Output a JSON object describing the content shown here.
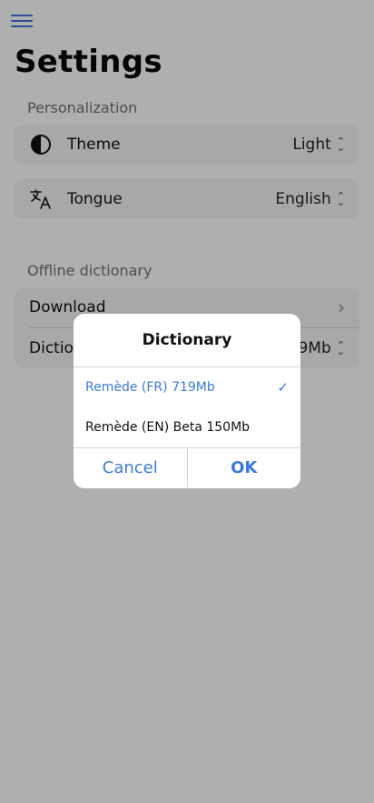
{
  "header": {
    "menu_icon": "hamburger-menu-icon",
    "title": "Settings"
  },
  "sections": {
    "personalization": {
      "label": "Personalization",
      "theme": {
        "icon": "half-circle-contrast-icon",
        "label": "Theme",
        "value": "Light"
      },
      "tongue": {
        "icon": "translate-icon",
        "label": "Tongue",
        "value": "English"
      }
    },
    "offline": {
      "label": "Offline dictionary",
      "download": {
        "label": "Download"
      },
      "dictionary": {
        "label": "Dictionary",
        "value": "Remède (FR) 719Mb"
      }
    }
  },
  "dialog": {
    "title": "Dictionary",
    "options": [
      {
        "label": "Remède (FR) 719Mb",
        "selected": true
      },
      {
        "label": "Remède (EN) Beta 150Mb",
        "selected": false
      }
    ],
    "cancel_label": "Cancel",
    "ok_label": "OK"
  },
  "colors": {
    "accent": "#3b7be0",
    "menu": "#3f6fd8",
    "overlay": "rgba(0,0,0,0.30)"
  }
}
